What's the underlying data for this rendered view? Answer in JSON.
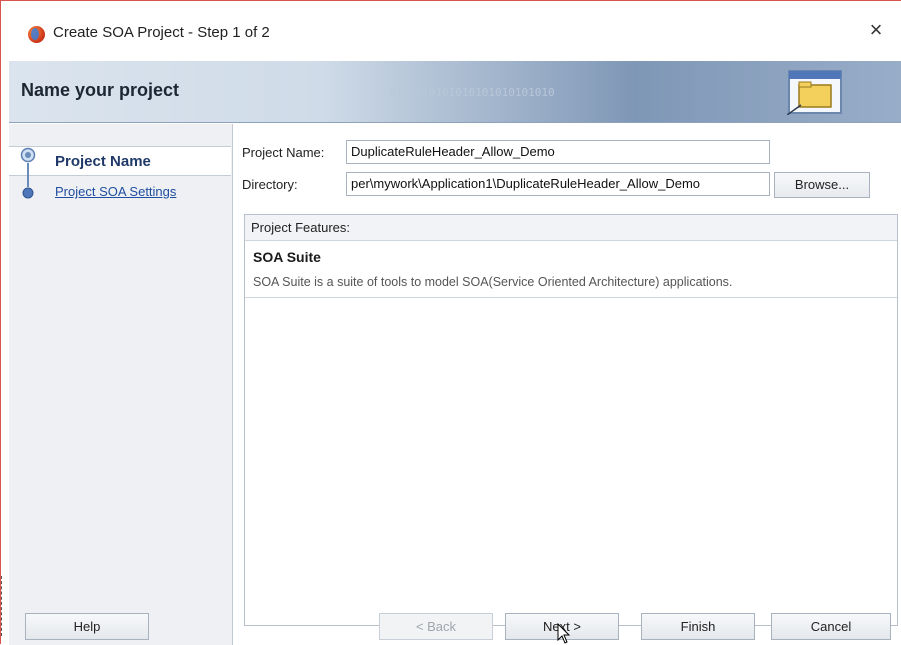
{
  "window": {
    "title": "Create SOA Project - Step 1 of 2",
    "close_glyph": "×",
    "app_icon": "jdeveloper-icon"
  },
  "banner": {
    "title": "Name your project",
    "decor_binary": "0101010101010101010101010",
    "icon": "folder-icon"
  },
  "nav": {
    "items": [
      {
        "label": "Project Name",
        "active": true
      },
      {
        "label": "Project SOA Settings",
        "active": false
      }
    ]
  },
  "form": {
    "project_name_label": "Project Name:",
    "project_name_value": "DuplicateRuleHeader_Allow_Demo",
    "directory_label": "Directory:",
    "directory_value": "per\\mywork\\Application1\\DuplicateRuleHeader_Allow_Demo",
    "browse_label": "Browse..."
  },
  "features": {
    "header": "Project Features:",
    "items": [
      {
        "title": "SOA Suite",
        "description": "SOA Suite is a suite of tools to model SOA(Service Oriented Architecture) applications."
      }
    ]
  },
  "footer": {
    "help_label": "Help",
    "back_label": "< Back",
    "next_label": "Next >",
    "finish_label": "Finish",
    "cancel_label": "Cancel"
  },
  "colors": {
    "banner_dark": "#7f97b6",
    "nav_link": "#1f4ea0",
    "nav_active": "#1f3a68"
  }
}
